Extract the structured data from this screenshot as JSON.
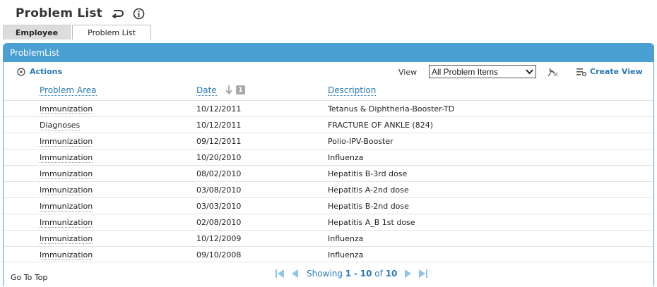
{
  "page": {
    "title": "Problem List"
  },
  "tabs": [
    {
      "label": "Employee"
    },
    {
      "label": "Problem List"
    }
  ],
  "panel": {
    "title": "ProblemList"
  },
  "toolbar": {
    "actions_label": "Actions",
    "view_label": "View",
    "view_selected": "All Problem Items",
    "create_view_label": "Create View"
  },
  "columns": {
    "area": "Problem Area",
    "date": "Date",
    "sort_priority": "1",
    "description": "Description"
  },
  "rows": [
    {
      "area": "Immunization",
      "date": "10/12/2011",
      "description": "Tetanus & Diphtheria-Booster-TD"
    },
    {
      "area": "Diagnoses",
      "date": "10/12/2011",
      "description": "FRACTURE OF ANKLE (824)"
    },
    {
      "area": "Immunization",
      "date": "09/12/2011",
      "description": "Polio-IPV-Booster"
    },
    {
      "area": "Immunization",
      "date": "10/20/2010",
      "description": "Influenza"
    },
    {
      "area": "Immunization",
      "date": "08/02/2010",
      "description": "Hepatitis B-3rd dose"
    },
    {
      "area": "Immunization",
      "date": "03/08/2010",
      "description": "Hepatitis A-2nd dose"
    },
    {
      "area": "Immunization",
      "date": "03/03/2010",
      "description": "Hepatitis B-2nd dose"
    },
    {
      "area": "Immunization",
      "date": "02/08/2010",
      "description": "Hepatitis A_B 1st dose"
    },
    {
      "area": "Immunization",
      "date": "10/12/2009",
      "description": "Influenza"
    },
    {
      "area": "Immunization",
      "date": "09/10/2008",
      "description": "Influenza"
    }
  ],
  "footer": {
    "go_top": "Go To Top",
    "showing_prefix": "Showing",
    "range_start": "1",
    "range_sep": "-",
    "range_end": "10",
    "of_label": "of",
    "total": "10"
  },
  "colors": {
    "header_blue": "#4a9fd3",
    "link_blue": "#2a7ab8",
    "pager_icon": "#8fc3e8"
  }
}
